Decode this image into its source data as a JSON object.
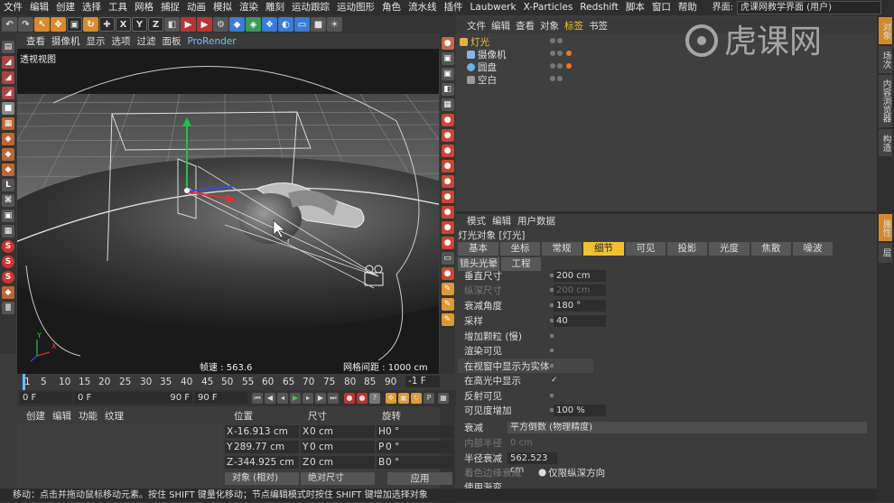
{
  "app": {
    "menubar": [
      "文件",
      "编辑",
      "创建",
      "选择",
      "工具",
      "网格",
      "捕捉",
      "动画",
      "模拟",
      "渲染",
      "雕刻",
      "运动跟踪",
      "运动图形",
      "角色",
      "流水线",
      "插件",
      "Laubwerk",
      "X-Particles",
      "Redshift",
      "脚本",
      "窗口",
      "帮助"
    ],
    "layout_label": "界面:",
    "layout_value": "虎课网教学界面 (用户)",
    "watermark": "虎课网"
  },
  "toolbar": {
    "axis_x": "X",
    "axis_y": "Y",
    "axis_z": "Z"
  },
  "viewport": {
    "menu": [
      "查看",
      "摄像机",
      "显示",
      "选项",
      "过滤",
      "面板",
      "ProRender"
    ],
    "label": "透视视图",
    "fps": "帧速 : 563.6",
    "grid": "网格间距 : 1000 cm",
    "axis_x": "X",
    "axis_y": "Y"
  },
  "object_manager": {
    "menu": [
      "文件",
      "编辑",
      "查看",
      "对象",
      "标签",
      "书签"
    ],
    "objects": [
      {
        "name": "灯光",
        "color": "#e8b040"
      },
      {
        "name": "摄像机",
        "color": "#8ab4e8"
      },
      {
        "name": "圆盘",
        "color": "#6ab0e0"
      },
      {
        "name": "空白",
        "color": "#9a9a9a"
      }
    ]
  },
  "side_tabs": [
    "对象",
    "场次",
    "内容浏览器",
    "构造",
    "属性",
    "层"
  ],
  "attributes": {
    "menu": [
      "模式",
      "编辑",
      "用户数据"
    ],
    "title": "灯光对象 [灯光]",
    "tabs_row1": [
      "基本",
      "坐标",
      "常规",
      "细节",
      "可见",
      "投影",
      "光度",
      "焦散",
      "噪波"
    ],
    "tabs_row2": [
      "镜头光晕",
      "工程"
    ],
    "active_tab": "细节",
    "rows": [
      {
        "label": "垂直尺寸",
        "value": "200 cm",
        "dim": false
      },
      {
        "label": "纵深尺寸",
        "value": "200 cm",
        "dim": true
      },
      {
        "label": "衰减角度",
        "value": "180 °",
        "dim": false
      },
      {
        "label": "采样",
        "value": "40",
        "dim": false
      },
      {
        "label": "增加颗粒 (慢)",
        "value": "",
        "dim": false
      },
      {
        "label": "渲染可见",
        "value": "",
        "dim": false
      },
      {
        "label": "在视窗中显示为实体",
        "value": "",
        "dim": false
      },
      {
        "label": "在高光中显示",
        "value": "✓",
        "dim": false
      },
      {
        "label": "反射可见",
        "value": "",
        "dim": false
      },
      {
        "label": "可见度增加",
        "value": "100 %",
        "dim": false
      }
    ],
    "falloff_label": "衰减",
    "falloff_value": "平方倒数 (物理精度)",
    "inner_radius_label": "内部半径",
    "inner_radius_value": "0 cm",
    "radius_label": "半径衰减",
    "radius_value": "562.523 cm",
    "color_falloff_label": "着色边缘衰减",
    "z_only_label": "仅限纵深方向",
    "gradient_label": "使用渐变"
  },
  "timeline": {
    "ticks": [
      "1",
      "5",
      "10",
      "15",
      "20",
      "25",
      "30",
      "35",
      "40",
      "45",
      "50",
      "55",
      "60",
      "65",
      "70",
      "75",
      "80",
      "85",
      "90"
    ],
    "end_label": "-1 F",
    "start_field": "0 F",
    "current_field": "0 F",
    "max_field": "90 F",
    "end_field": "90 F"
  },
  "material": {
    "menu": [
      "创建",
      "编辑",
      "功能",
      "纹理"
    ]
  },
  "coordinates": {
    "headers": [
      "位置",
      "尺寸",
      "旋转"
    ],
    "pos": [
      {
        "axis": "X",
        "value": "-16.913 cm"
      },
      {
        "axis": "Y",
        "value": "289.77 cm"
      },
      {
        "axis": "Z",
        "value": "-344.925 cm"
      }
    ],
    "size": [
      {
        "axis": "X",
        "value": "0 cm"
      },
      {
        "axis": "Y",
        "value": "0 cm"
      },
      {
        "axis": "Z",
        "value": "0 cm"
      }
    ],
    "rot": [
      {
        "axis": "H",
        "value": "0 °"
      },
      {
        "axis": "P",
        "value": "0 °"
      },
      {
        "axis": "B",
        "value": "0 °"
      }
    ],
    "mode": "对象 (相对)",
    "size_mode": "绝对尺寸",
    "apply": "应用"
  },
  "status": "移动：点击并拖动鼠标移动元素。按住 SHIFT 键量化移动；节点编辑模式时按住 SHIFT 键增加选择对象"
}
